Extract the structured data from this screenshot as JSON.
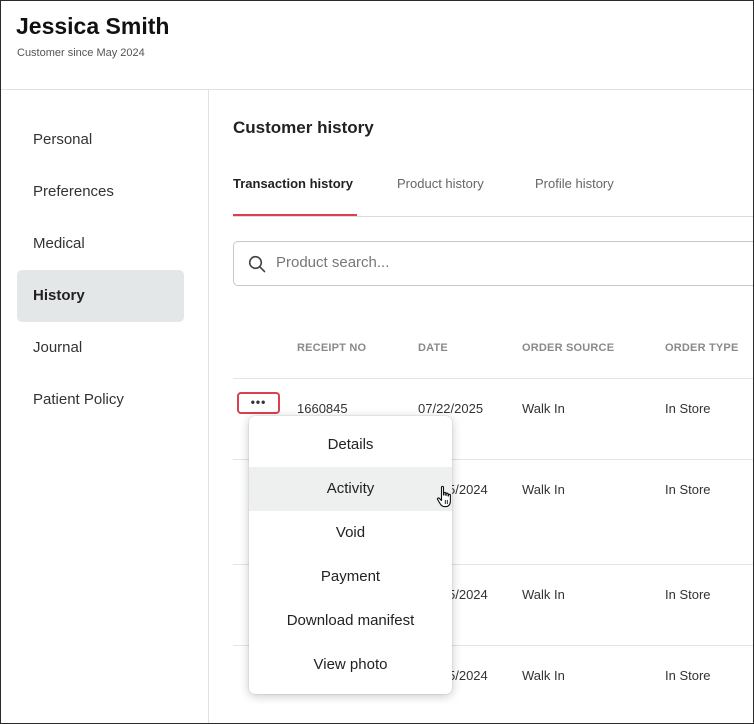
{
  "customer": {
    "name": "Jessica Smith",
    "since": "Customer since May 2024"
  },
  "sidebar": {
    "items": [
      {
        "label": "Personal"
      },
      {
        "label": "Preferences"
      },
      {
        "label": "Medical"
      },
      {
        "label": "History",
        "active": true
      },
      {
        "label": "Journal"
      },
      {
        "label": "Patient Policy"
      }
    ]
  },
  "main": {
    "title": "Customer history",
    "tabs": [
      {
        "label": "Transaction history",
        "active": true
      },
      {
        "label": "Product history"
      },
      {
        "label": "Profile history"
      }
    ],
    "search": {
      "placeholder": "Product search...",
      "value": ""
    },
    "table": {
      "headers": [
        "RECEIPT NO",
        "DATE",
        "ORDER SOURCE",
        "ORDER TYPE"
      ],
      "rows": [
        {
          "receipt": "1660845",
          "date": "07/22/2025",
          "source": "Walk In",
          "type": "In Store"
        },
        {
          "date": "5/2024",
          "source": "Walk In",
          "type": "In Store"
        },
        {
          "date": "5/2024",
          "source": "Walk In",
          "type": "In Store"
        },
        {
          "date": "5/2024",
          "source": "Walk In",
          "type": "In Store"
        }
      ],
      "more_label": "•••"
    }
  },
  "context_menu": {
    "items": [
      "Details",
      "Activity",
      "Void",
      "Payment",
      "Download manifest",
      "View photo"
    ],
    "hovered": "Activity"
  },
  "colors": {
    "accent": "#d9414f",
    "active_nav_bg": "#e4e7e8",
    "hover_bg": "#eef0f0"
  },
  "icons": {
    "search": "search-icon",
    "cursor": "hand-pointer-icon"
  }
}
